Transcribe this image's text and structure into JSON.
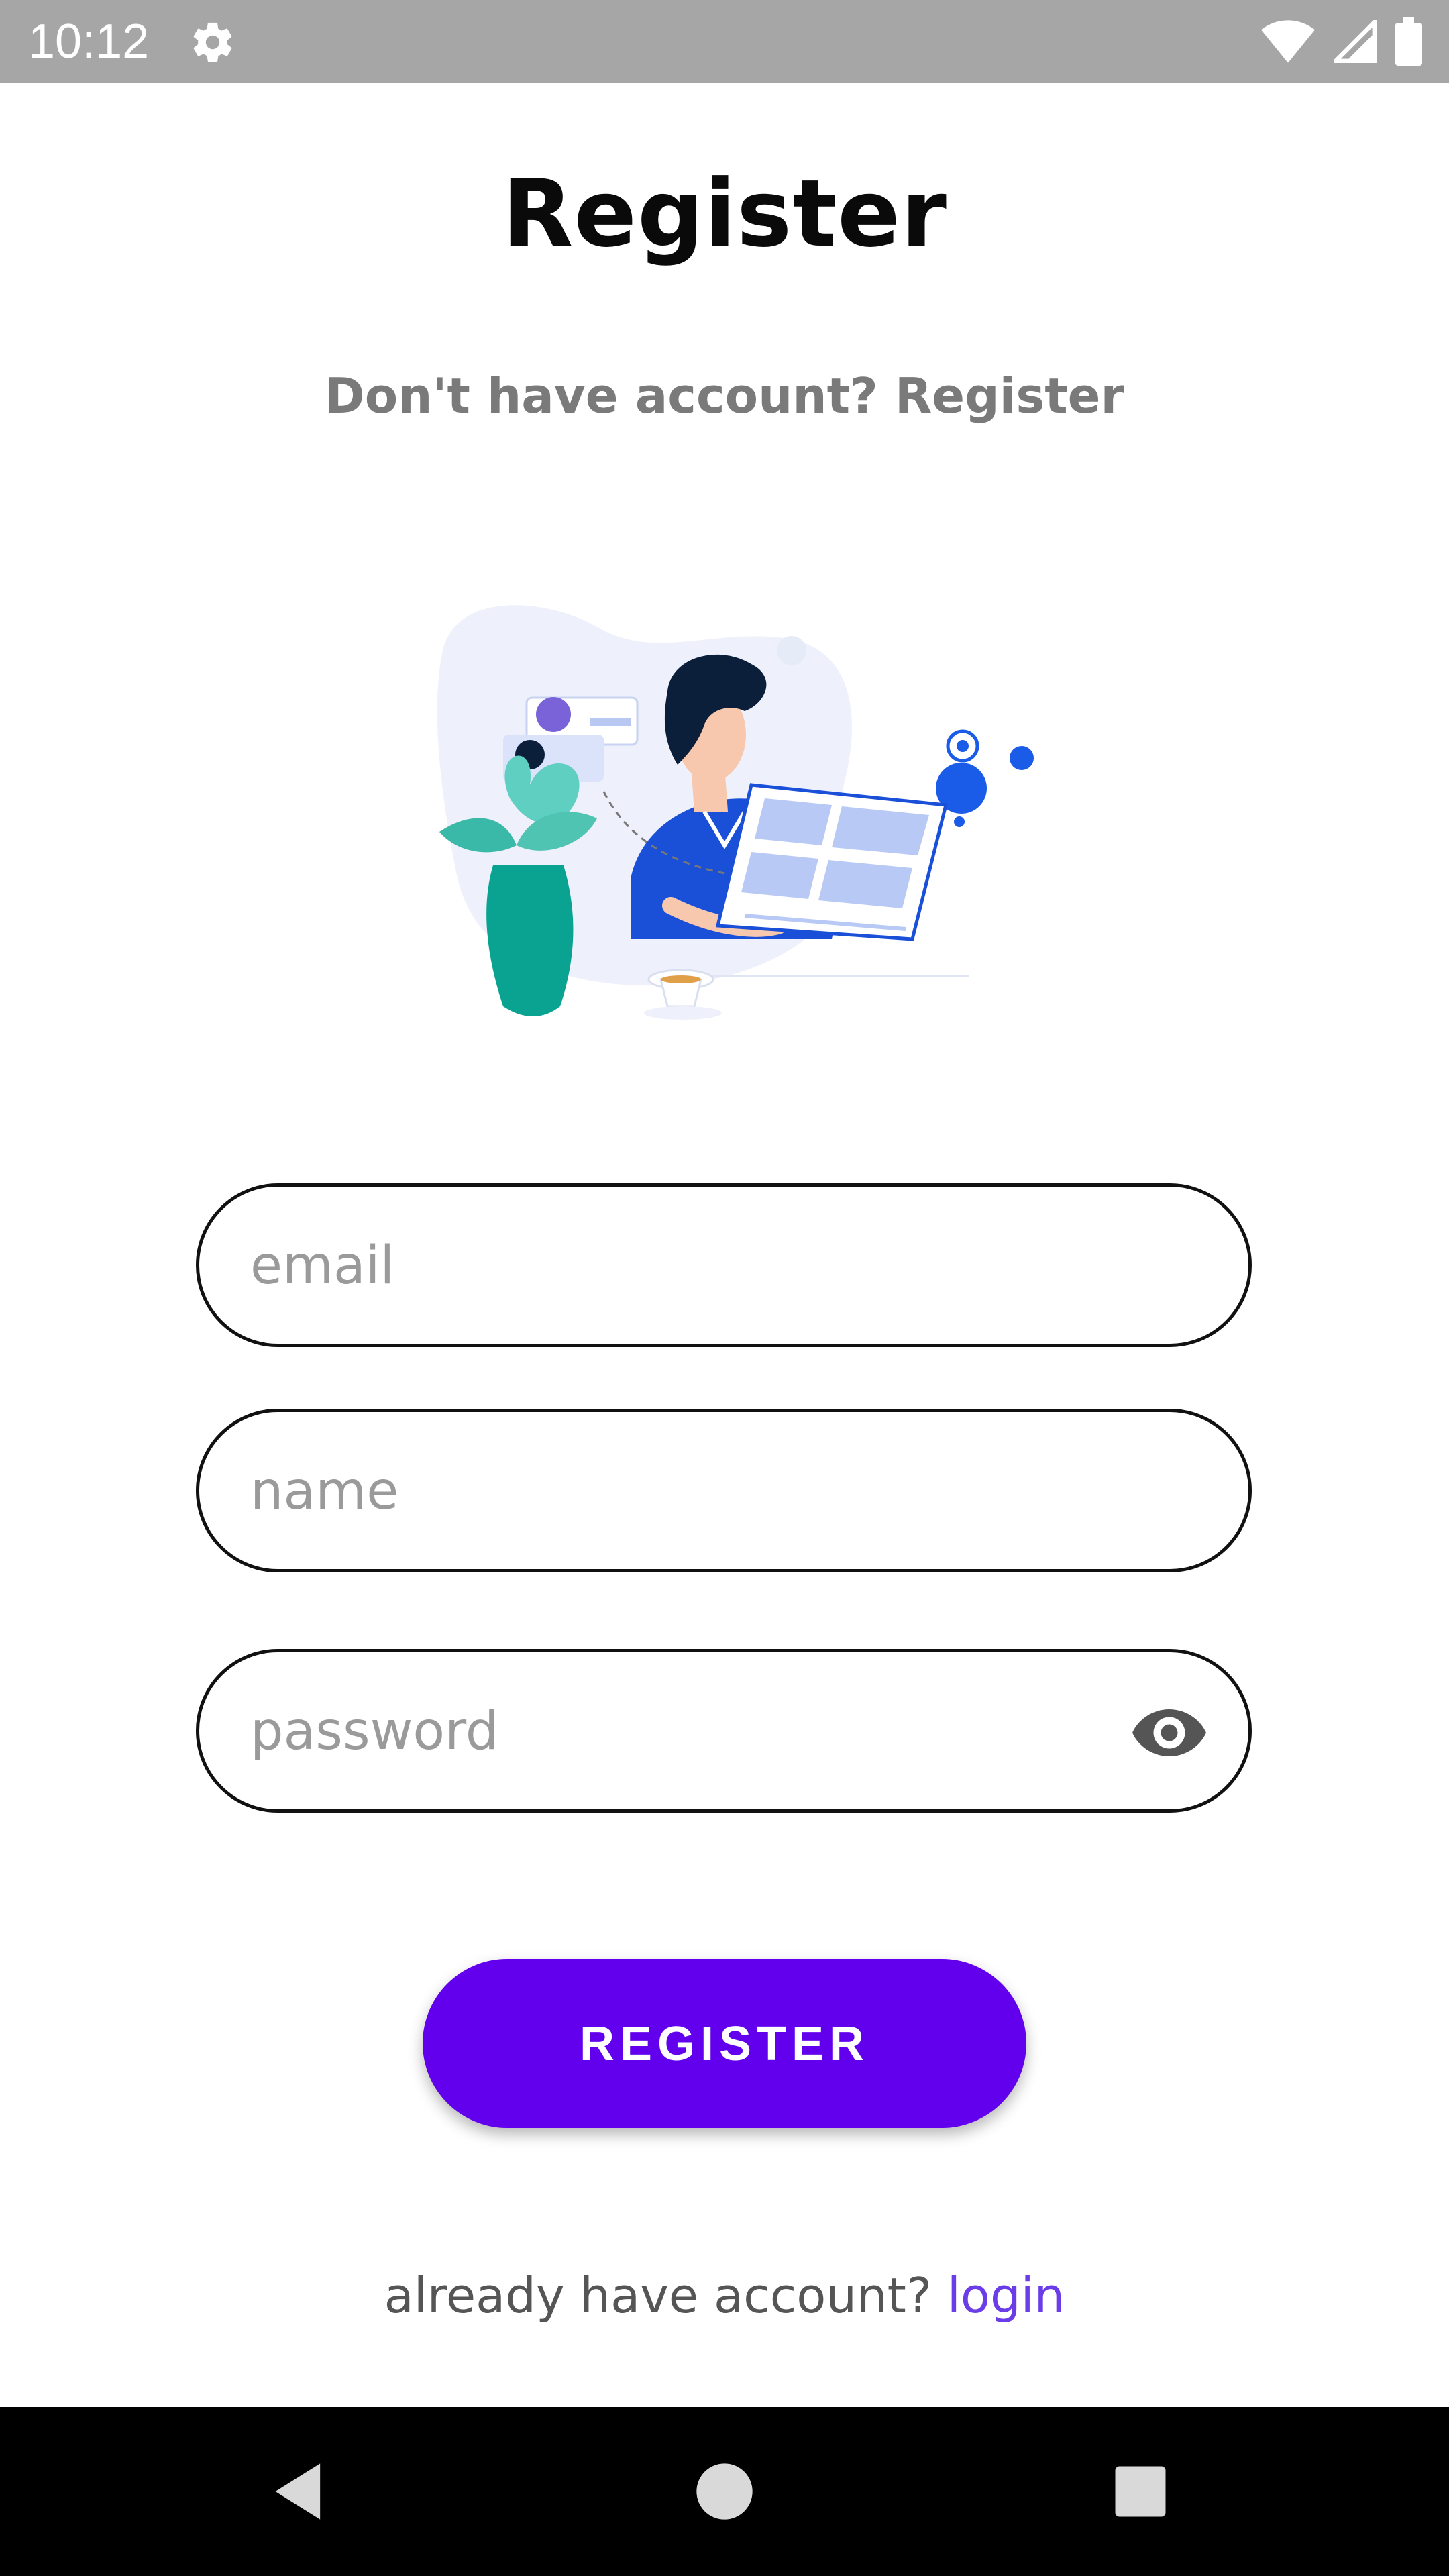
{
  "status_bar": {
    "time": "10:12"
  },
  "header": {
    "title": "Register",
    "subtitle": "Don't have account? Register"
  },
  "form": {
    "email_placeholder": "email",
    "name_placeholder": "name",
    "password_placeholder": "password",
    "submit_label": "REGISTER"
  },
  "footer": {
    "prompt": "already have account? ",
    "login_link": "login"
  },
  "colors": {
    "accent": "#6200ee",
    "link": "#6a3de8",
    "status_bar": "#a6a6a6"
  },
  "icons": [
    "gear-icon",
    "wifi-icon",
    "signal-icon",
    "battery-icon",
    "eye-icon",
    "back-icon",
    "home-icon",
    "recents-icon"
  ]
}
